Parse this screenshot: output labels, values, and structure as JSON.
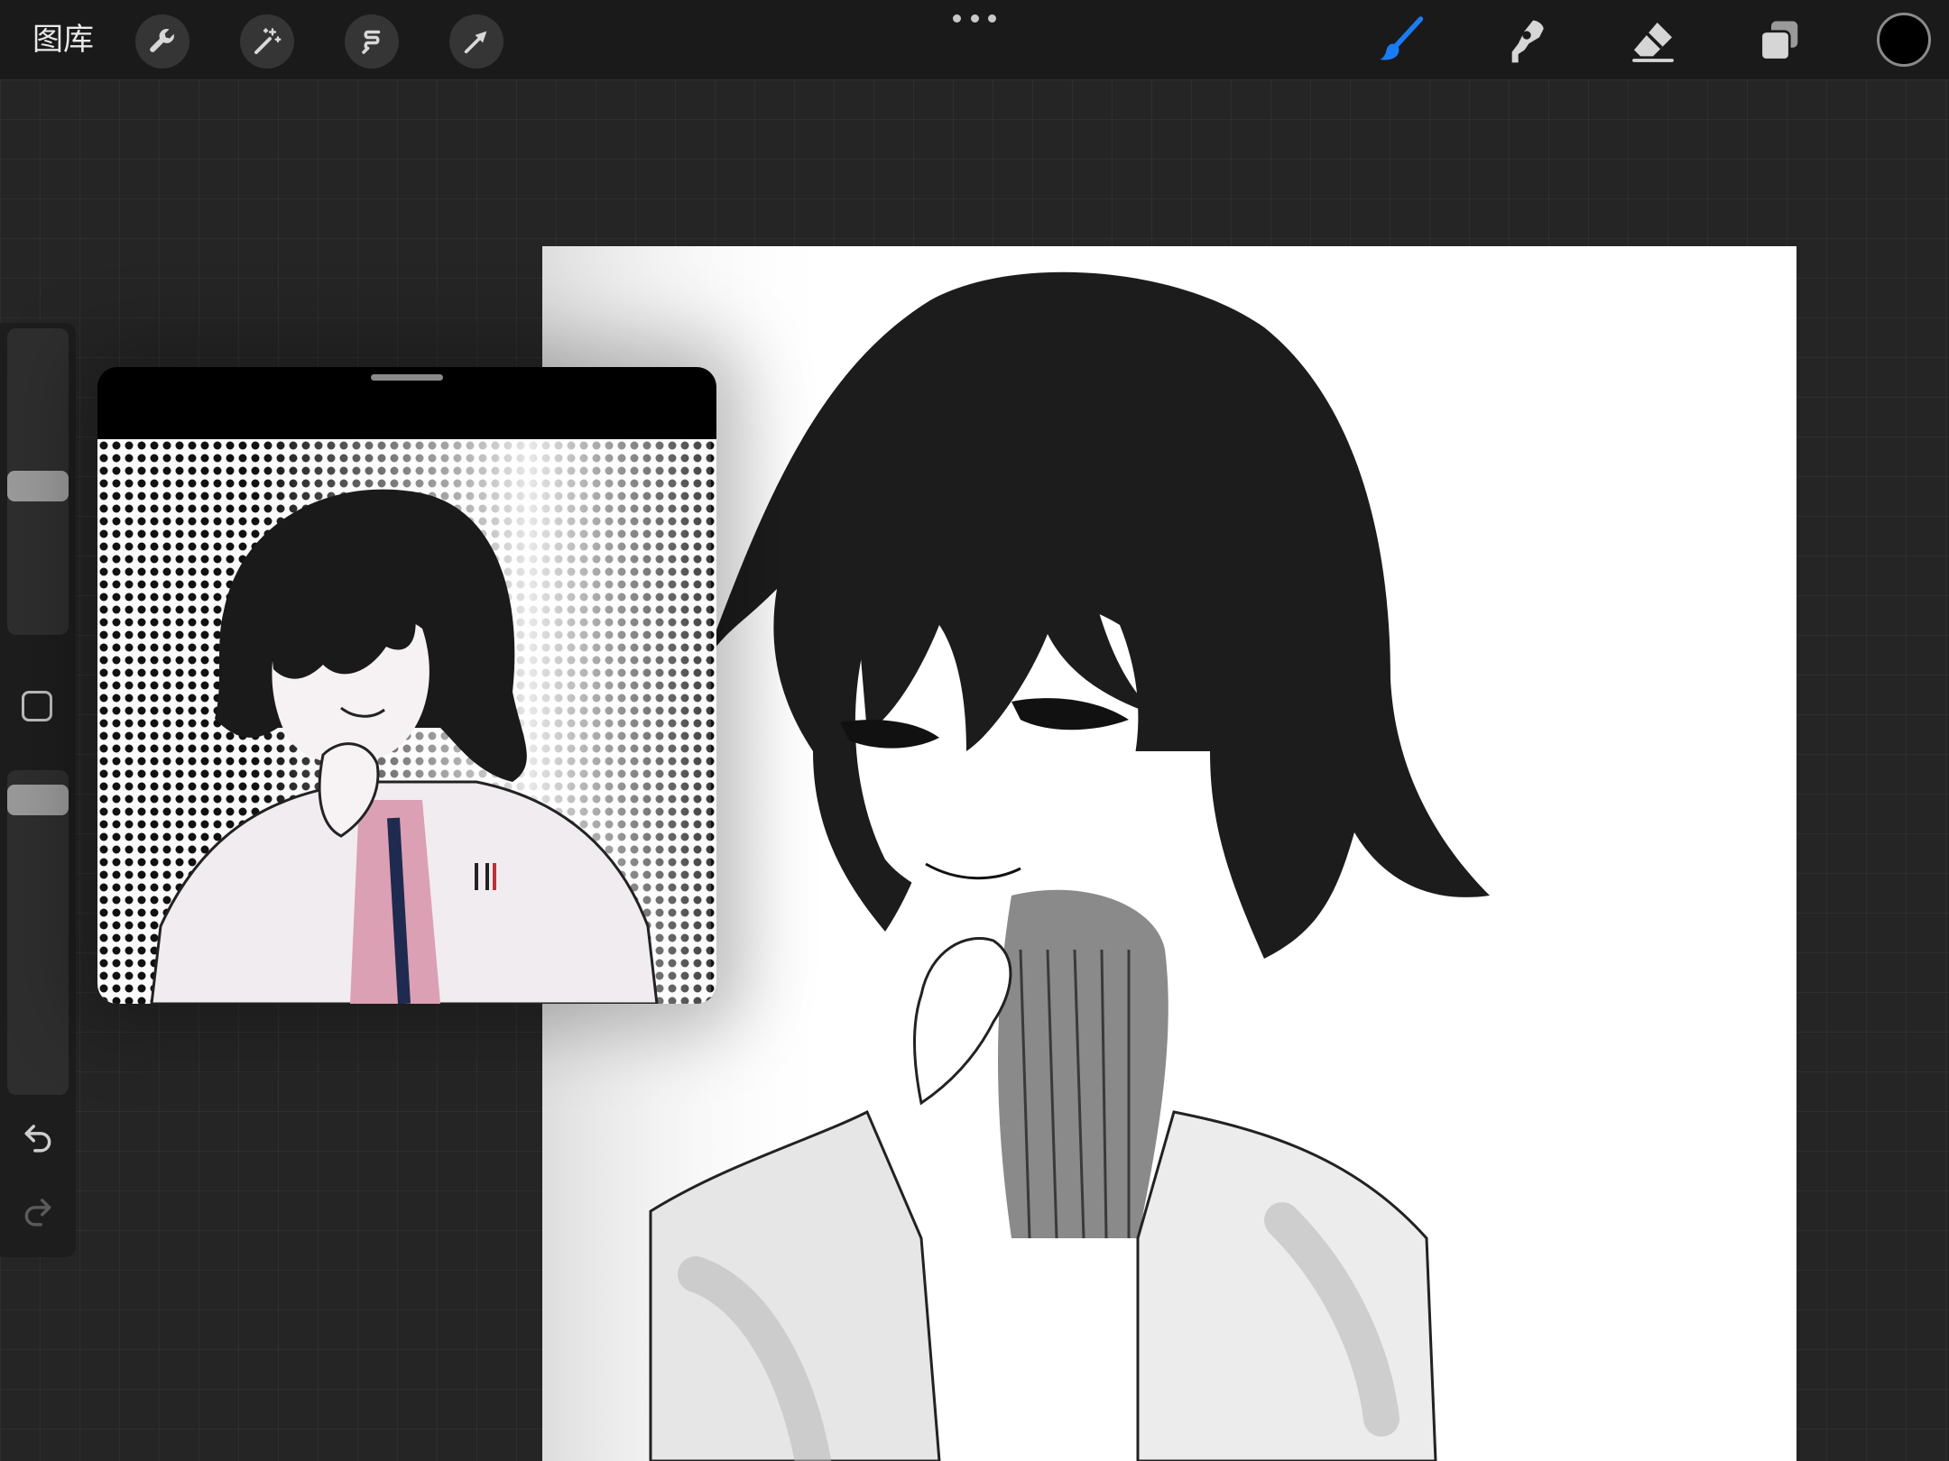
{
  "toolbar": {
    "gallery_label": "图库",
    "left_tools": [
      {
        "icon": "wrench-icon",
        "name": "actions"
      },
      {
        "icon": "magic-wand-icon",
        "name": "adjustments"
      },
      {
        "icon": "selection-icon",
        "name": "selection"
      },
      {
        "icon": "arrow-cursor-icon",
        "name": "transform"
      }
    ],
    "right_tools": [
      {
        "icon": "brush-icon",
        "name": "paint",
        "active": true
      },
      {
        "icon": "smudge-icon",
        "name": "smudge",
        "active": false
      },
      {
        "icon": "eraser-icon",
        "name": "eraser",
        "active": false
      },
      {
        "icon": "layers-icon",
        "name": "layers",
        "active": false
      }
    ],
    "active_color": "#000000",
    "accent_color": "#1a7cf5"
  },
  "sidebar": {
    "brush_size_level": 0.52,
    "opacity_level": 0.8,
    "buttons": [
      "modify-button",
      "undo-button",
      "redo-button"
    ]
  },
  "reference": {
    "title": ""
  }
}
